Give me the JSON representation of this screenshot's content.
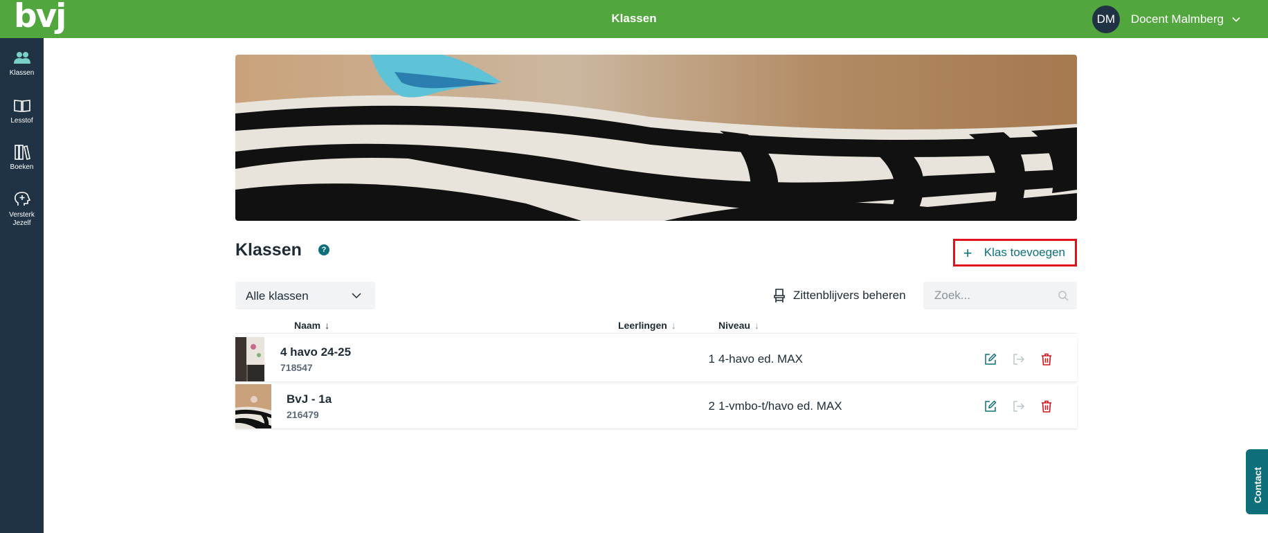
{
  "app": {
    "logo": "bvj",
    "page_title": "Klassen"
  },
  "user": {
    "initials": "DM",
    "name": "Docent Malmberg"
  },
  "colors": {
    "topbar": "#52a63e",
    "sidebar": "#1f3344",
    "accent": "#0e6f7a",
    "danger": "#d0121b",
    "highlight_border": "#e0121b"
  },
  "sidebar": {
    "items": [
      {
        "label": "Klassen",
        "icon": "users-icon",
        "active": true
      },
      {
        "label": "Lesstof",
        "icon": "book-open-icon",
        "active": false
      },
      {
        "label": "Boeken",
        "icon": "books-icon",
        "active": false
      },
      {
        "label": "Versterk Jezelf",
        "icon": "brain-plus-icon",
        "active": false
      }
    ]
  },
  "main": {
    "title": "Klassen",
    "help_icon": "question-circle-icon",
    "add_button": "Klas toevoegen",
    "filter": {
      "selected": "Alle klassen"
    },
    "manage_button": "Zittenblijvers beheren",
    "search": {
      "placeholder": "Zoek...",
      "value": ""
    },
    "columns": {
      "name": "Naam",
      "students": "Leerlingen",
      "level": "Niveau"
    },
    "rows": [
      {
        "name": "4 havo 24-25",
        "code": "718547",
        "students": "1",
        "level": "4-havo ed. MAX"
      },
      {
        "name": "BvJ - 1a",
        "code": "216479",
        "students": "2",
        "level": "1-vmbo-t/havo ed. MAX"
      }
    ]
  },
  "contact": {
    "label": "Contact"
  }
}
